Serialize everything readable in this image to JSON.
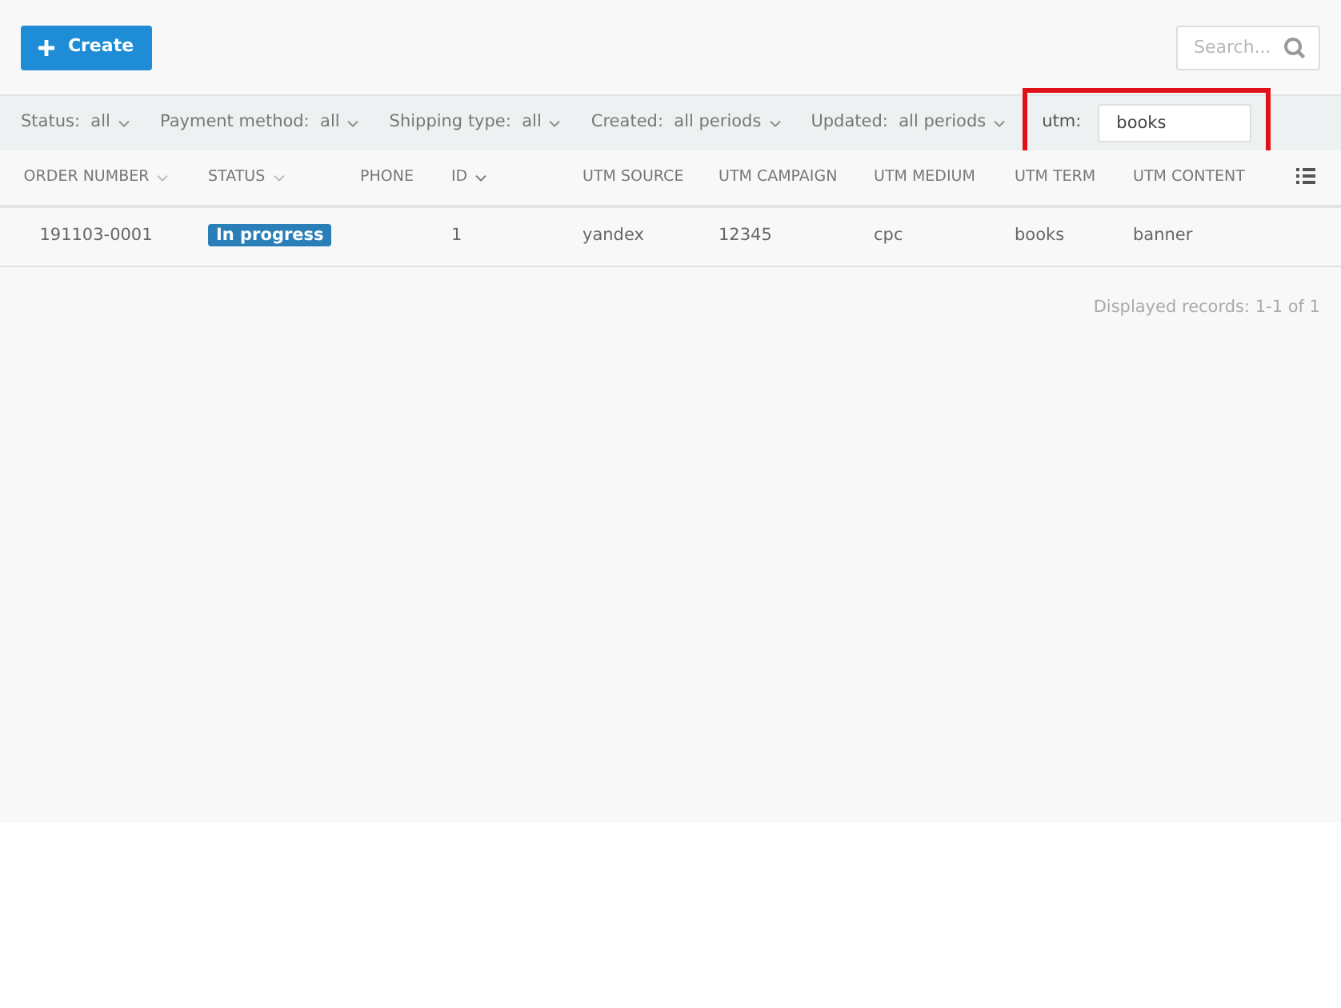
{
  "toolbar": {
    "create_button": "Create",
    "search": {
      "placeholder": "Search..."
    }
  },
  "filters": [
    {
      "label": "Status:",
      "value": "all",
      "kind": "dropdown",
      "highlighted": false
    },
    {
      "label": "Payment method:",
      "value": "all",
      "kind": "dropdown",
      "highlighted": false
    },
    {
      "label": "Shipping type:",
      "value": "all",
      "kind": "dropdown",
      "highlighted": false
    },
    {
      "label": "Created:",
      "value": "all periods",
      "kind": "dropdown",
      "highlighted": false
    },
    {
      "label": "Updated:",
      "value": "all periods",
      "kind": "dropdown",
      "highlighted": false
    },
    {
      "label": "utm:",
      "value": "books",
      "kind": "text",
      "highlighted": true
    }
  ],
  "table": {
    "columns": [
      {
        "label": "ORDER NUMBER",
        "sort_caret": true
      },
      {
        "label": "STATUS",
        "sort_caret": true
      },
      {
        "label": "PHONE",
        "sort_caret": false
      },
      {
        "label": "ID",
        "sort_caret": true
      },
      {
        "label": "UTM SOURCE",
        "sort_caret": false
      },
      {
        "label": "UTM CAMPAIGN",
        "sort_caret": false
      },
      {
        "label": "UTM MEDIUM",
        "sort_caret": false
      },
      {
        "label": "UTM TERM",
        "sort_caret": false
      },
      {
        "label": "UTM CONTENT",
        "sort_caret": false
      }
    ],
    "rows": [
      [
        "191103-0001",
        "In progress",
        "",
        "1",
        "yandex",
        "12345",
        "cpc",
        "books",
        "banner"
      ]
    ]
  },
  "footer": "Displayed records: 1-1 of 1"
}
